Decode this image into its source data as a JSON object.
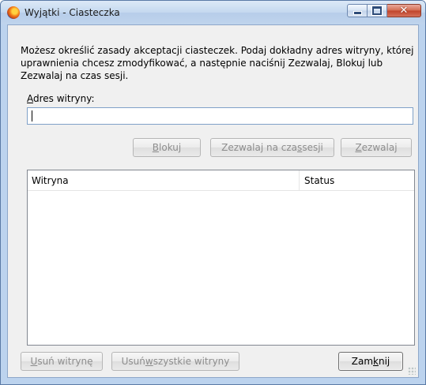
{
  "window": {
    "title": "Wyjątki - Ciasteczka"
  },
  "intro": {
    "text": "Możesz określić zasady akceptacji ciasteczek. Podaj dokładny adres witryny, której uprawnienia chcesz zmodyfikować, a następnie naciśnij Zezwalaj, Blokuj lub Zezwalaj na czas sesji."
  },
  "address": {
    "label_prefix": "A",
    "label_rest": "dres witryny:",
    "value": "",
    "placeholder": ""
  },
  "actions": {
    "block": {
      "pre": "",
      "key": "B",
      "post": "lokuj"
    },
    "session": {
      "pre": "Zezwalaj na cza",
      "key": "s",
      "post": " sesji"
    },
    "allow": {
      "pre": "",
      "key": "Z",
      "post": "ezwalaj"
    }
  },
  "list": {
    "columns": [
      "Witryna",
      "Status"
    ],
    "rows": []
  },
  "footer": {
    "remove": {
      "pre": "",
      "key": "U",
      "post": "suń witrynę"
    },
    "remove_all": {
      "pre": "Usuń ",
      "key": "w",
      "post": "szystkie witryny"
    },
    "close": {
      "pre": "Zam",
      "key": "k",
      "post": "nij"
    }
  },
  "colors": {
    "titlebar": "#c4d8ef",
    "client_bg": "#f0f0f0",
    "close_button": "#c0432a"
  }
}
